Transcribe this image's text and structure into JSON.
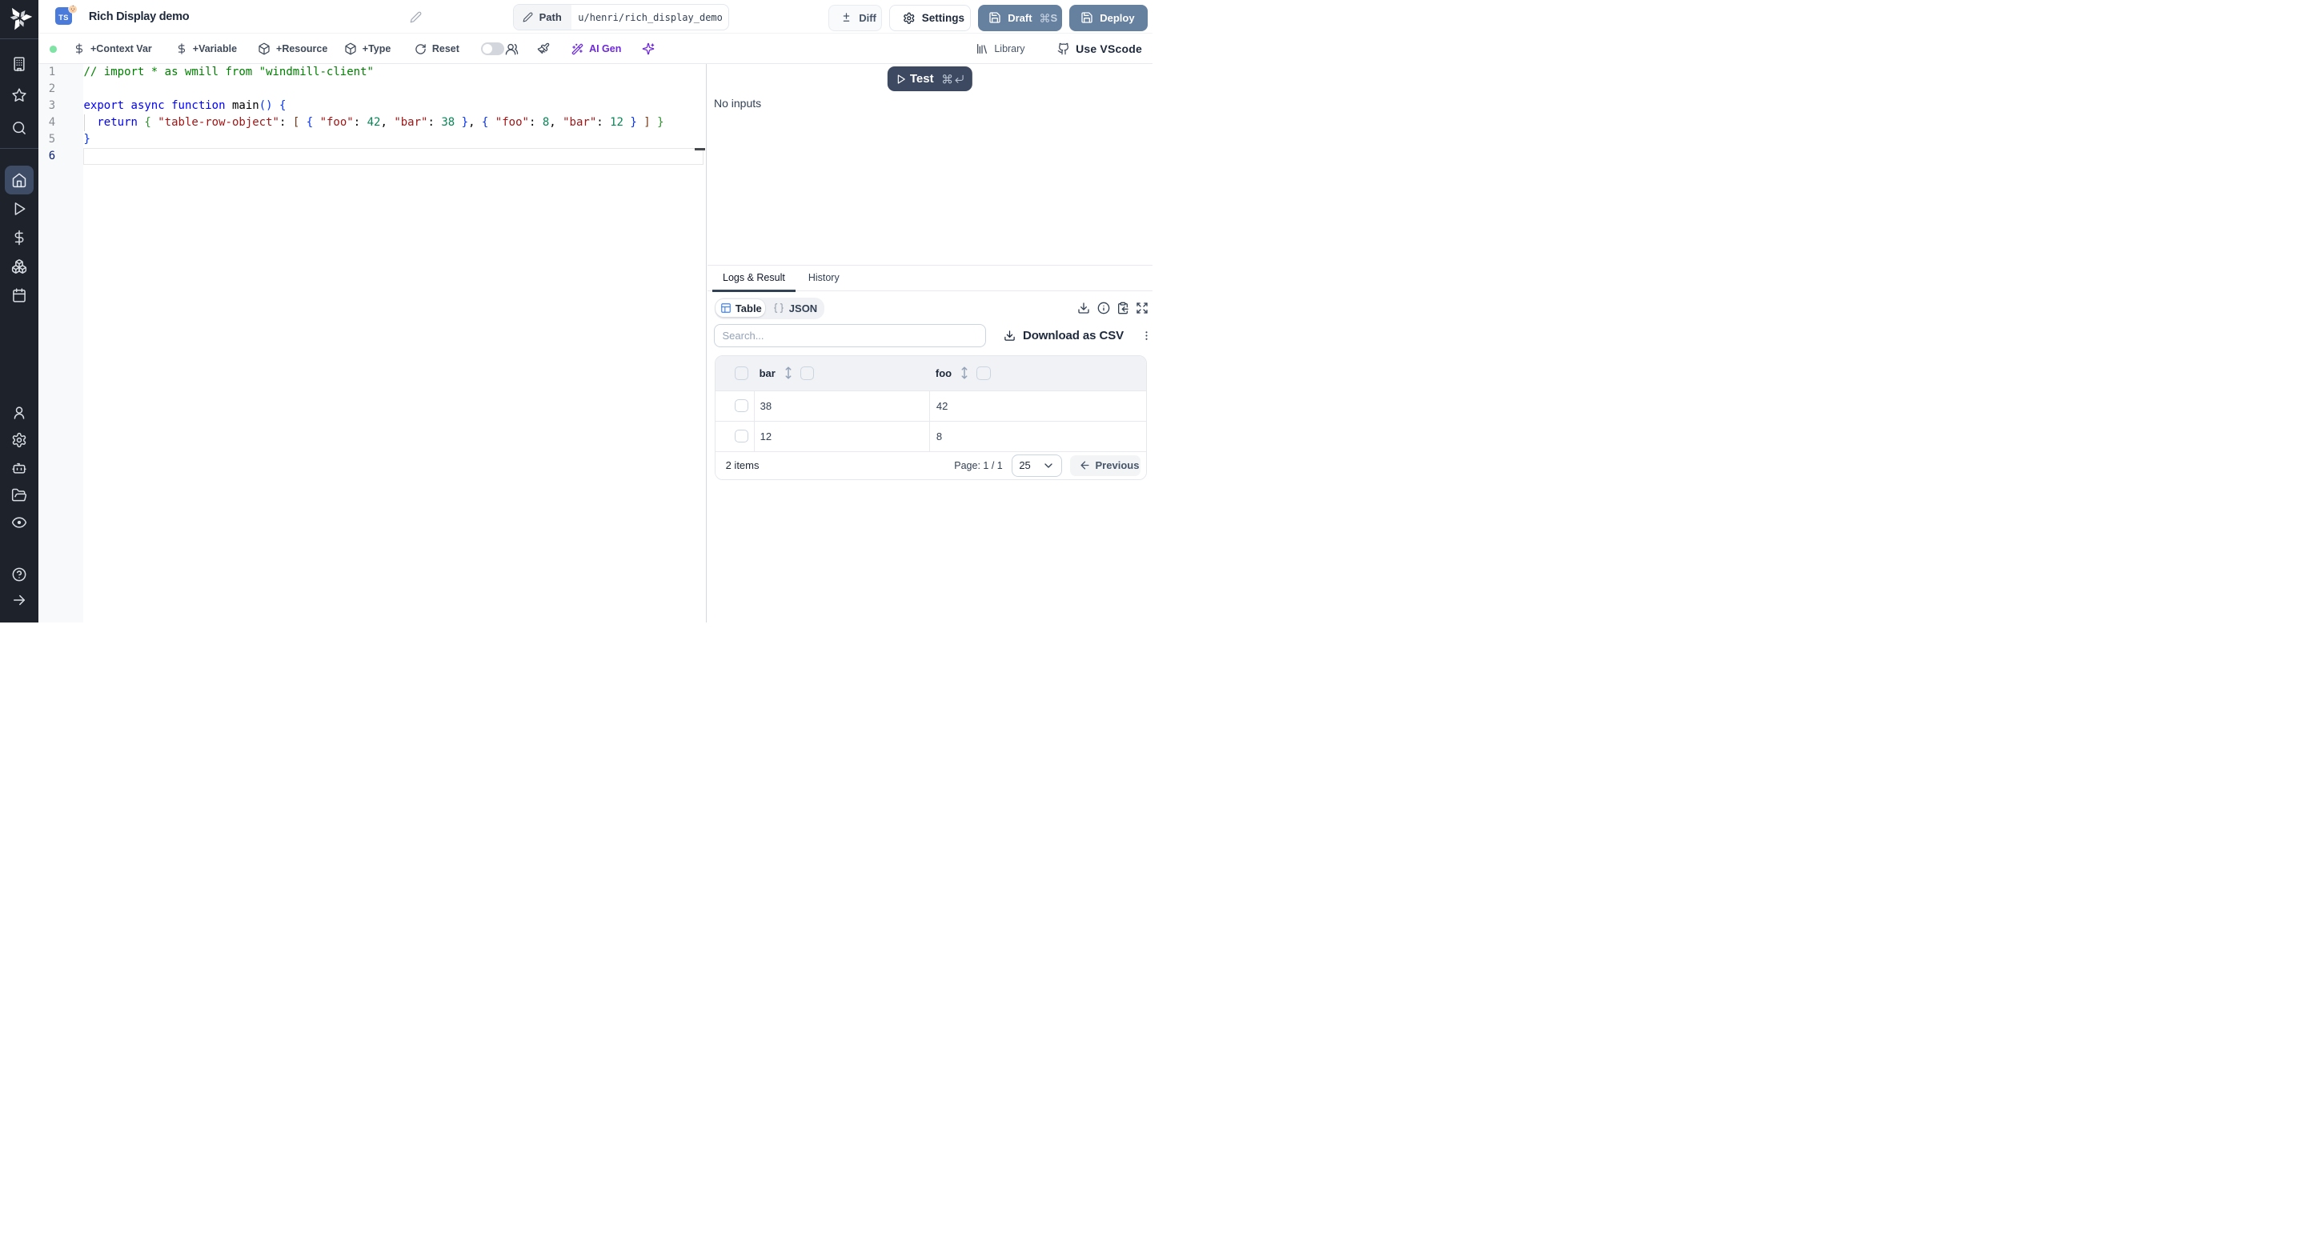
{
  "colors": {
    "accent_blue": "#4a7edc",
    "draft_deploy_bg": "#66809f",
    "test_bg": "#38465f",
    "ai_purple": "#6d28d9",
    "status_green": "#7fe3a4",
    "sidebar_bg": "#1d222b",
    "syntax": {
      "comment": "#008000",
      "keyword": "#0000ff",
      "string": "#a31515",
      "number": "#098658",
      "bracket1": "#0431fa",
      "bracket2": "#319331",
      "bracket3": "#7b3814"
    }
  },
  "sidebar": {
    "items": [
      {
        "name": "workspace"
      },
      {
        "name": "favorites"
      },
      {
        "name": "search"
      },
      {
        "name": "home",
        "active": true
      },
      {
        "name": "runs"
      },
      {
        "name": "variables"
      },
      {
        "name": "resources"
      },
      {
        "name": "schedules"
      },
      {
        "name": "user"
      },
      {
        "name": "settings"
      },
      {
        "name": "workers"
      },
      {
        "name": "folders"
      },
      {
        "name": "audit"
      },
      {
        "name": "help"
      },
      {
        "name": "collapse"
      }
    ]
  },
  "header": {
    "language_badge": "TS",
    "title": "Rich Display demo",
    "path_label": "Path",
    "path_value": "u/henri/rich_display_demo",
    "diff_label": "Diff",
    "settings_label": "Settings",
    "draft_label": "Draft",
    "draft_kbd": "S",
    "deploy_label": "Deploy"
  },
  "toolbar": {
    "context_var_label": "+Context Var",
    "variable_label": "+Variable",
    "resource_label": "+Resource",
    "type_label": "+Type",
    "reset_label": "Reset",
    "ai_gen_label": "AI Gen",
    "library_label": "Library",
    "vscode_label": "Use VScode"
  },
  "editor": {
    "lines": [
      [
        {
          "t": "// import * as wmill from \"windmill-client\"",
          "c": "c"
        }
      ],
      [],
      [
        {
          "t": "export",
          "c": "k"
        },
        {
          "t": " ",
          "c": "d"
        },
        {
          "t": "async",
          "c": "k"
        },
        {
          "t": " ",
          "c": "d"
        },
        {
          "t": "function",
          "c": "k"
        },
        {
          "t": " main",
          "c": "d"
        },
        {
          "t": "()",
          "c": "b1"
        },
        {
          "t": " ",
          "c": "d"
        },
        {
          "t": "{",
          "c": "b1"
        }
      ],
      [
        {
          "t": "  ",
          "c": "d"
        },
        {
          "t": "return",
          "c": "k"
        },
        {
          "t": " ",
          "c": "d"
        },
        {
          "t": "{",
          "c": "b2"
        },
        {
          "t": " ",
          "c": "d"
        },
        {
          "t": "\"table-row-object\"",
          "c": "s"
        },
        {
          "t": ": ",
          "c": "d"
        },
        {
          "t": "[",
          "c": "b3"
        },
        {
          "t": " ",
          "c": "d"
        },
        {
          "t": "{",
          "c": "b1"
        },
        {
          "t": " ",
          "c": "d"
        },
        {
          "t": "\"foo\"",
          "c": "s"
        },
        {
          "t": ": ",
          "c": "d"
        },
        {
          "t": "42",
          "c": "n"
        },
        {
          "t": ", ",
          "c": "d"
        },
        {
          "t": "\"bar\"",
          "c": "s"
        },
        {
          "t": ": ",
          "c": "d"
        },
        {
          "t": "38",
          "c": "n"
        },
        {
          "t": " ",
          "c": "d"
        },
        {
          "t": "}",
          "c": "b1"
        },
        {
          "t": ", ",
          "c": "d"
        },
        {
          "t": "{",
          "c": "b1"
        },
        {
          "t": " ",
          "c": "d"
        },
        {
          "t": "\"foo\"",
          "c": "s"
        },
        {
          "t": ": ",
          "c": "d"
        },
        {
          "t": "8",
          "c": "n"
        },
        {
          "t": ", ",
          "c": "d"
        },
        {
          "t": "\"bar\"",
          "c": "s"
        },
        {
          "t": ": ",
          "c": "d"
        },
        {
          "t": "12",
          "c": "n"
        },
        {
          "t": " ",
          "c": "d"
        },
        {
          "t": "}",
          "c": "b1"
        },
        {
          "t": " ",
          "c": "d"
        },
        {
          "t": "]",
          "c": "b3"
        },
        {
          "t": " ",
          "c": "d"
        },
        {
          "t": "}",
          "c": "b2"
        }
      ],
      [
        {
          "t": "}",
          "c": "b1"
        }
      ],
      []
    ],
    "active_line": 6
  },
  "panel": {
    "test_label": "Test",
    "no_inputs": "No inputs",
    "tabs": [
      {
        "label": "Logs & Result",
        "active": true
      },
      {
        "label": "History",
        "active": false
      }
    ],
    "view_toggle": {
      "table_label": "Table",
      "json_label": "JSON"
    },
    "search_placeholder": "Search...",
    "download_csv_label": "Download as CSV"
  },
  "result_table": {
    "columns": [
      "bar",
      "foo"
    ],
    "rows": [
      [
        "38",
        "42"
      ],
      [
        "12",
        "8"
      ]
    ],
    "items_text": "2 items",
    "page_text": "Page: 1 / 1",
    "page_size": "25",
    "previous_label": "Previous"
  }
}
